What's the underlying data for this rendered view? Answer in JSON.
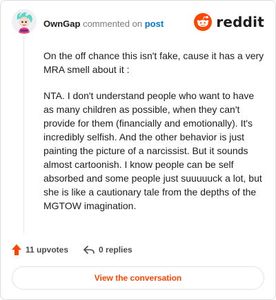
{
  "header": {
    "username": "OwnGap",
    "action": "commented on",
    "link": "post",
    "brand": "reddit"
  },
  "icons": {
    "avatar": "avatar",
    "logo": "reddit-logo-icon",
    "upvote": "upvote-arrow-icon",
    "reply": "reply-arrow-icon"
  },
  "colors": {
    "accent": "#ff4500",
    "link": "#0079d3",
    "text": "#1c1c1c",
    "muted": "#7c7c7c"
  },
  "comment": {
    "paragraphs": [
      "On the off chance this isn't fake, cause it has a very MRA smell about it :",
      "NTA. I don't understand people who want to have as many children as possible, when they can't provide for them (financially and emotionally). It's incredibly selfish. And the other behavior is just painting the picture of a narcissist. But it sounds almost cartoonish. I know people can be self absorbed and some people just suuuuuck a lot, but she is like a cautionary tale from the depths of the MGTOW imagination."
    ]
  },
  "footer": {
    "upvotes": "11 upvotes",
    "replies": "0 replies"
  },
  "button": {
    "label": "View the conversation"
  }
}
